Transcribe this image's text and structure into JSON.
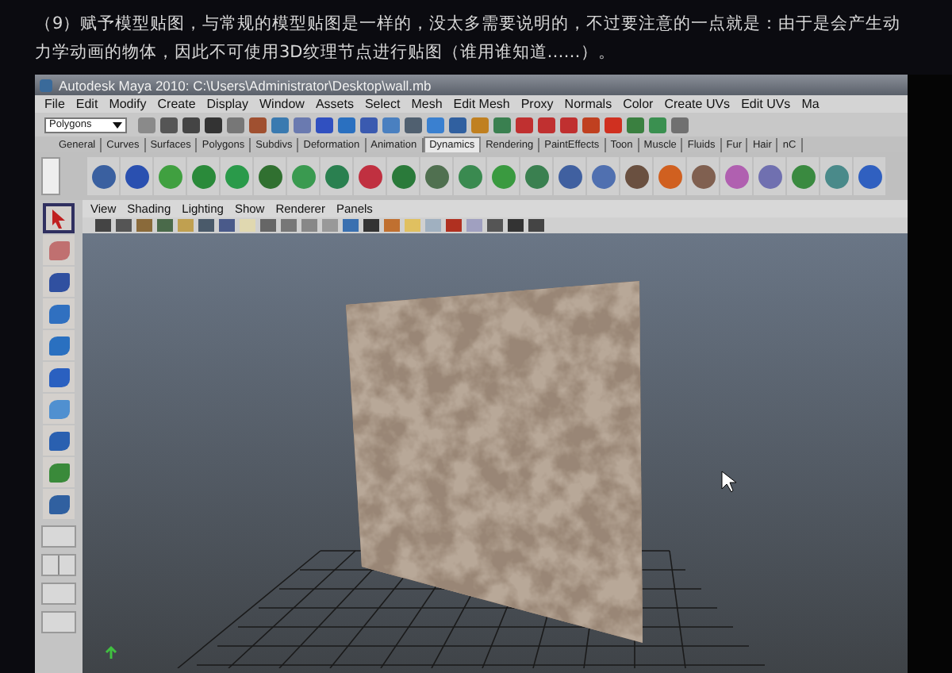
{
  "intro_text": "（9）赋予模型贴图，与常规的模型贴图是一样的，没太多需要说明的，不过要注意的一点就是：由于是会产生动力学动画的物体，因此不可使用3D纹理节点进行贴图（谁用谁知道……）。",
  "window": {
    "title": "Autodesk Maya 2010: C:\\Users\\Administrator\\Desktop\\wall.mb"
  },
  "menu_bar": [
    "File",
    "Edit",
    "Modify",
    "Create",
    "Display",
    "Window",
    "Assets",
    "Select",
    "Mesh",
    "Edit Mesh",
    "Proxy",
    "Normals",
    "Color",
    "Create UVs",
    "Edit UVs",
    "Ma"
  ],
  "menu_set": {
    "value": "Polygons"
  },
  "shelf_tabs": [
    {
      "label": "General",
      "selected": false
    },
    {
      "label": "Curves",
      "selected": false
    },
    {
      "label": "Surfaces",
      "selected": false
    },
    {
      "label": "Polygons",
      "selected": false
    },
    {
      "label": "Subdivs",
      "selected": false
    },
    {
      "label": "Deformation",
      "selected": false
    },
    {
      "label": "Animation",
      "selected": false
    },
    {
      "label": "Dynamics",
      "selected": true
    },
    {
      "label": "Rendering",
      "selected": false
    },
    {
      "label": "PaintEffects",
      "selected": false
    },
    {
      "label": "Toon",
      "selected": false
    },
    {
      "label": "Muscle",
      "selected": false
    },
    {
      "label": "Fluids",
      "selected": false
    },
    {
      "label": "Fur",
      "selected": false
    },
    {
      "label": "Hair",
      "selected": false
    },
    {
      "label": "nC",
      "selected": false
    }
  ],
  "panel_menu": [
    "View",
    "Shading",
    "Lighting",
    "Show",
    "Renderer",
    "Panels"
  ]
}
